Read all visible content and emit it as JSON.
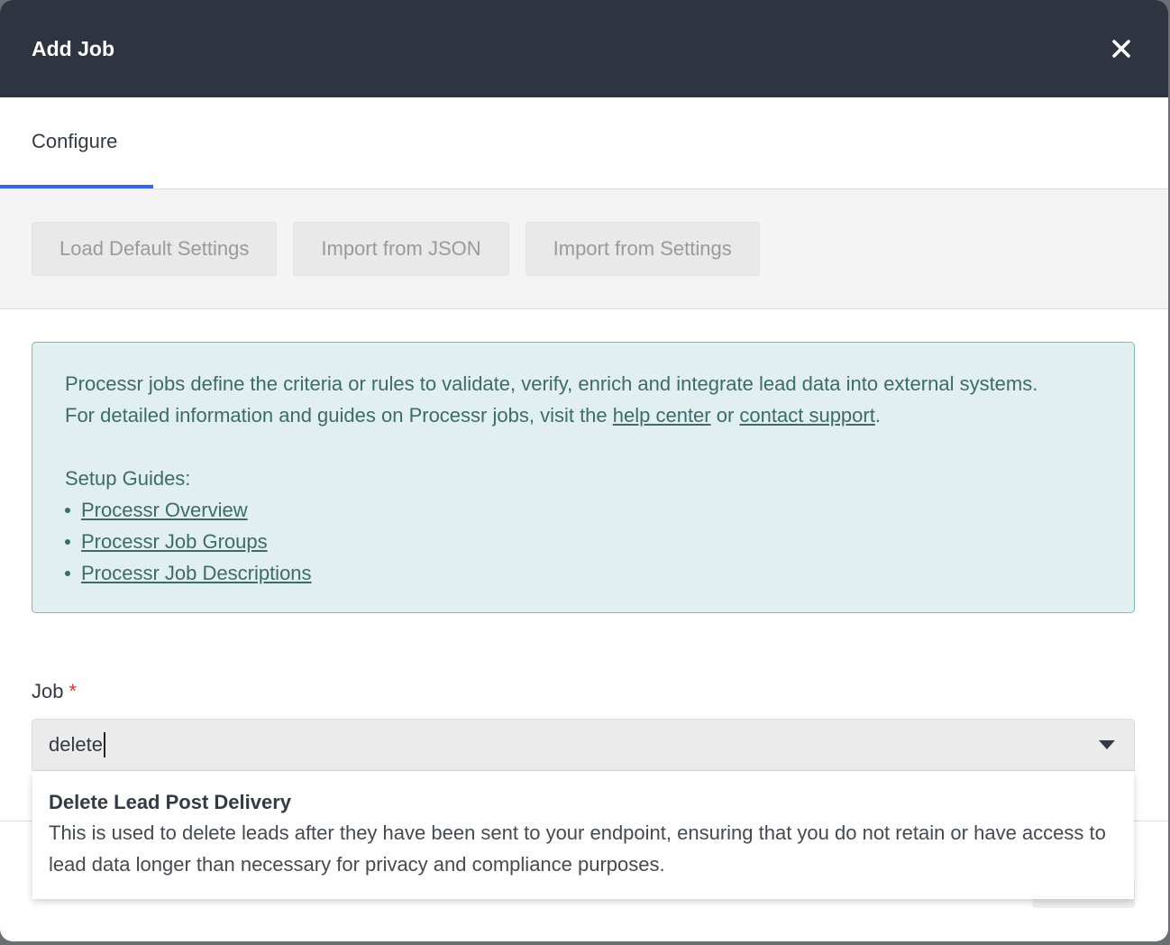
{
  "modal": {
    "title": "Add Job",
    "close_icon": "close-icon"
  },
  "tabs": [
    {
      "label": "Configure",
      "active": true
    }
  ],
  "toolbar": {
    "load_default": "Load Default Settings",
    "import_json": "Import from JSON",
    "import_settings": "Import from Settings"
  },
  "info": {
    "line1": "Processr jobs define the criteria or rules to validate, verify, enrich and integrate lead data into external systems.",
    "line2_prefix": "For detailed information and guides on Processr jobs, visit the ",
    "help_center": "help center",
    "or": " or ",
    "contact_support": "contact support",
    "period": ".",
    "setup_guides": "Setup Guides:",
    "guides": [
      "Processr Overview",
      "Processr Job Groups",
      "Processr Job Descriptions"
    ]
  },
  "job_field": {
    "label": "Job",
    "required_mark": "*",
    "value": "delete",
    "chevron_icon": "chevron-down-icon"
  },
  "dropdown": {
    "options": [
      {
        "title": "Delete Lead Post Delivery",
        "description": "This is used to delete leads after they have been sent to your endpoint, ensuring that you do not retain or have access to lead data longer than necessary for privacy and compliance purposes."
      }
    ]
  },
  "colors": {
    "header_bg": "#2e3440",
    "tab_accent": "#2f6bdc",
    "info_bg": "#e2eff0",
    "info_border": "#77bcb6",
    "info_text": "#3d6b6a",
    "required": "#d0342c"
  }
}
